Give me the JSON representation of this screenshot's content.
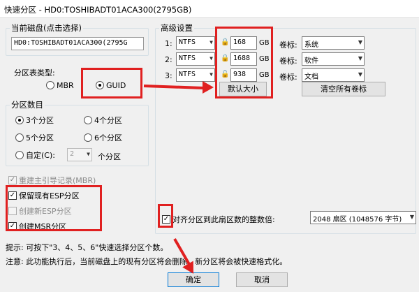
{
  "window": {
    "title": "快速分区 - HD0:TOSHIBADT01ACA300(2795GB)"
  },
  "disk": {
    "label": "当前磁盘(点击选择)",
    "value": "HD0:TOSHIBADT01ACA300(2795G"
  },
  "partition_type": {
    "label": "分区表类型:",
    "mbr": "MBR",
    "guid": "GUID",
    "selected": "GUID"
  },
  "partition_count": {
    "label": "分区数目",
    "options": [
      "3个分区",
      "4个分区",
      "5个分区",
      "6个分区"
    ],
    "selected": "3个分区",
    "custom_label": "自定(C):",
    "custom_value": "2",
    "custom_suffix": "个分区"
  },
  "checkboxes": {
    "rebuild_mbr": "重建主引导记录(MBR)",
    "keep_esp": "保留现有ESP分区",
    "create_esp": "创建新ESP分区",
    "create_msr": "创建MSR分区"
  },
  "advanced": {
    "label": "高级设置",
    "rows": [
      {
        "index": "1:",
        "fs": "NTFS",
        "size": "168",
        "unit": "GB",
        "vol_label": "卷标:",
        "vol": "系统"
      },
      {
        "index": "2:",
        "fs": "NTFS",
        "size": "1688",
        "unit": "GB",
        "vol_label": "卷标:",
        "vol": "软件"
      },
      {
        "index": "3:",
        "fs": "NTFS",
        "size": "938",
        "unit": "GB",
        "vol_label": "卷标:",
        "vol": "文档"
      }
    ],
    "default_size_btn": "默认大小",
    "clear_labels_btn": "清空所有卷标"
  },
  "align": {
    "label": "对齐分区到此扇区数的整数倍:",
    "value": "2048 扇区 (1048576 字节)"
  },
  "hints": {
    "line1": "提示: 可按下\"3、4、5、6\"快速选择分区个数。",
    "line2": "注意: 此功能执行后，当前磁盘上的现有分区将会删除。新分区将会被快速格式化。"
  },
  "buttons": {
    "ok": "确定",
    "cancel": "取消"
  },
  "colors": {
    "annotation": "#e02020"
  }
}
